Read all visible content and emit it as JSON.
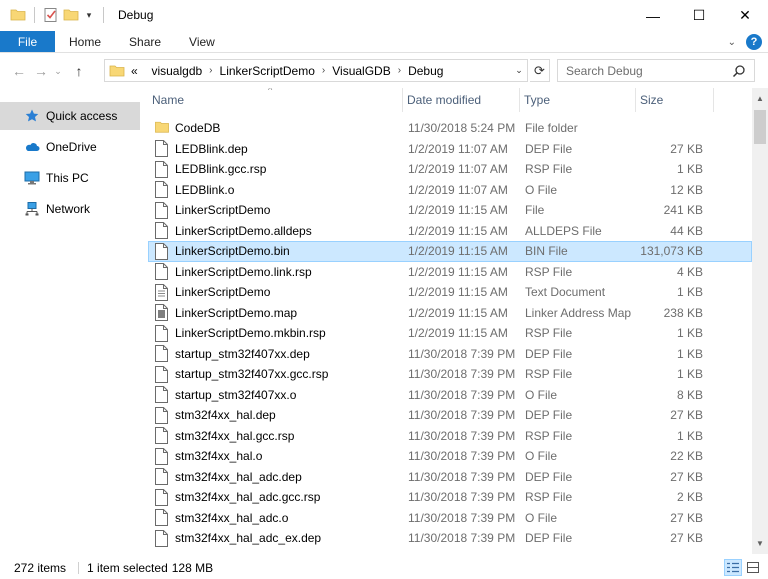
{
  "window": {
    "title": "Debug"
  },
  "window_controls": {
    "minimize": "—",
    "maximize": "☐",
    "close": "✕"
  },
  "ribbon": {
    "file_tab": "File",
    "tabs": [
      "Home",
      "Share",
      "View"
    ],
    "help": "?"
  },
  "address": {
    "overflow": "«",
    "crumbs": [
      "visualgdb",
      "LinkerScriptDemo",
      "VisualGDB",
      "Debug"
    ]
  },
  "search": {
    "placeholder": "Search Debug"
  },
  "sidebar": {
    "items": [
      {
        "label": "Quick access",
        "icon": "star-icon"
      },
      {
        "label": "OneDrive",
        "icon": "cloud-icon"
      },
      {
        "label": "This PC",
        "icon": "monitor-icon"
      },
      {
        "label": "Network",
        "icon": "network-icon"
      }
    ]
  },
  "columns": {
    "name": "Name",
    "date": "Date modified",
    "type": "Type",
    "size": "Size"
  },
  "files": [
    {
      "name": "CodeDB",
      "date": "11/30/2018 5:24 PM",
      "type": "File folder",
      "size": "",
      "icon": "folder-icon"
    },
    {
      "name": "LEDBlink.dep",
      "date": "1/2/2019 11:07 AM",
      "type": "DEP File",
      "size": "27 KB",
      "icon": "file-icon"
    },
    {
      "name": "LEDBlink.gcc.rsp",
      "date": "1/2/2019 11:07 AM",
      "type": "RSP File",
      "size": "1 KB",
      "icon": "file-icon"
    },
    {
      "name": "LEDBlink.o",
      "date": "1/2/2019 11:07 AM",
      "type": "O File",
      "size": "12 KB",
      "icon": "file-icon"
    },
    {
      "name": "LinkerScriptDemo",
      "date": "1/2/2019 11:15 AM",
      "type": "File",
      "size": "241 KB",
      "icon": "file-icon"
    },
    {
      "name": "LinkerScriptDemo.alldeps",
      "date": "1/2/2019 11:15 AM",
      "type": "ALLDEPS File",
      "size": "44 KB",
      "icon": "file-icon"
    },
    {
      "name": "LinkerScriptDemo.bin",
      "date": "1/2/2019 11:15 AM",
      "type": "BIN File",
      "size": "131,073 KB",
      "icon": "file-icon",
      "selected": true
    },
    {
      "name": "LinkerScriptDemo.link.rsp",
      "date": "1/2/2019 11:15 AM",
      "type": "RSP File",
      "size": "4 KB",
      "icon": "file-icon"
    },
    {
      "name": "LinkerScriptDemo",
      "date": "1/2/2019 11:15 AM",
      "type": "Text Document",
      "size": "1 KB",
      "icon": "text-file-icon"
    },
    {
      "name": "LinkerScriptDemo.map",
      "date": "1/2/2019 11:15 AM",
      "type": "Linker Address Map",
      "size": "238 KB",
      "icon": "map-file-icon"
    },
    {
      "name": "LinkerScriptDemo.mkbin.rsp",
      "date": "1/2/2019 11:15 AM",
      "type": "RSP File",
      "size": "1 KB",
      "icon": "file-icon"
    },
    {
      "name": "startup_stm32f407xx.dep",
      "date": "11/30/2018 7:39 PM",
      "type": "DEP File",
      "size": "1 KB",
      "icon": "file-icon"
    },
    {
      "name": "startup_stm32f407xx.gcc.rsp",
      "date": "11/30/2018 7:39 PM",
      "type": "RSP File",
      "size": "1 KB",
      "icon": "file-icon"
    },
    {
      "name": "startup_stm32f407xx.o",
      "date": "11/30/2018 7:39 PM",
      "type": "O File",
      "size": "8 KB",
      "icon": "file-icon"
    },
    {
      "name": "stm32f4xx_hal.dep",
      "date": "11/30/2018 7:39 PM",
      "type": "DEP File",
      "size": "27 KB",
      "icon": "file-icon"
    },
    {
      "name": "stm32f4xx_hal.gcc.rsp",
      "date": "11/30/2018 7:39 PM",
      "type": "RSP File",
      "size": "1 KB",
      "icon": "file-icon"
    },
    {
      "name": "stm32f4xx_hal.o",
      "date": "11/30/2018 7:39 PM",
      "type": "O File",
      "size": "22 KB",
      "icon": "file-icon"
    },
    {
      "name": "stm32f4xx_hal_adc.dep",
      "date": "11/30/2018 7:39 PM",
      "type": "DEP File",
      "size": "27 KB",
      "icon": "file-icon"
    },
    {
      "name": "stm32f4xx_hal_adc.gcc.rsp",
      "date": "11/30/2018 7:39 PM",
      "type": "RSP File",
      "size": "2 KB",
      "icon": "file-icon"
    },
    {
      "name": "stm32f4xx_hal_adc.o",
      "date": "11/30/2018 7:39 PM",
      "type": "O File",
      "size": "27 KB",
      "icon": "file-icon"
    },
    {
      "name": "stm32f4xx_hal_adc_ex.dep",
      "date": "11/30/2018 7:39 PM",
      "type": "DEP File",
      "size": "27 KB",
      "icon": "file-icon"
    }
  ],
  "status": {
    "item_count": "272 items",
    "selection": "1 item selected",
    "selection_size": "128 MB"
  },
  "colors": {
    "accent": "#1979ca",
    "selected_row": "#cce8ff",
    "selected_border": "#99d1ff",
    "folder": "#f8d775"
  }
}
